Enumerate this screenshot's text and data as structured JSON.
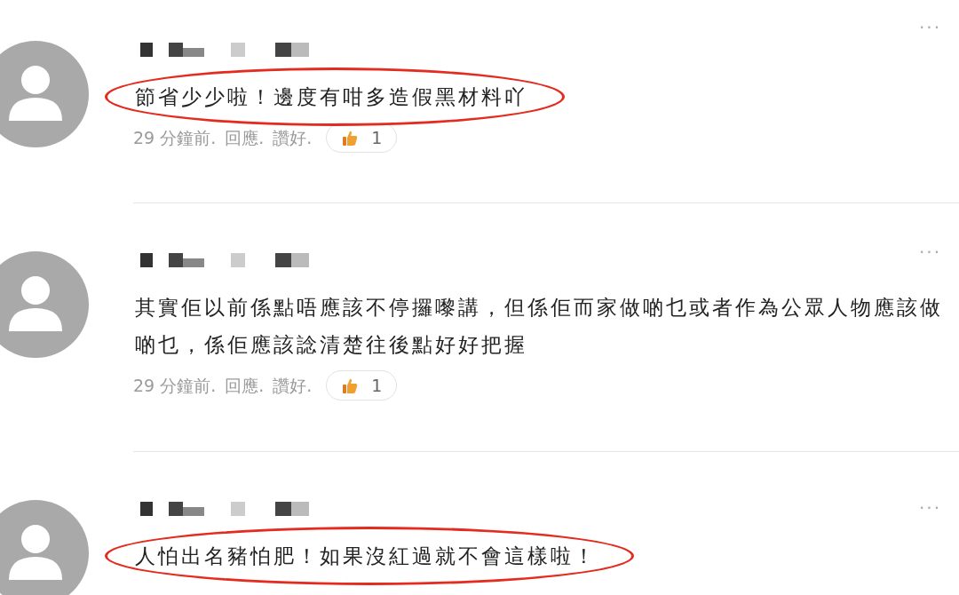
{
  "comments": [
    {
      "text": "節省少少啦！邊度有咁多造假黑材料吖",
      "highlighted": true,
      "time": "29 分鐘前.",
      "reply": "回應.",
      "like": "讚好.",
      "likes": "1",
      "more": "···"
    },
    {
      "text": "其實佢以前係點唔應該不停攞嚟講，但係佢而家做啲乜或者作為公眾人物應該做啲乜，係佢應該諗清楚往後點好好把握",
      "highlighted": false,
      "time": "29 分鐘前.",
      "reply": "回應.",
      "like": "讚好.",
      "likes": "1",
      "more": "···"
    },
    {
      "text": "人怕出名豬怕肥！如果沒紅過就不會這樣啦！",
      "highlighted": true,
      "more": "···"
    }
  ]
}
